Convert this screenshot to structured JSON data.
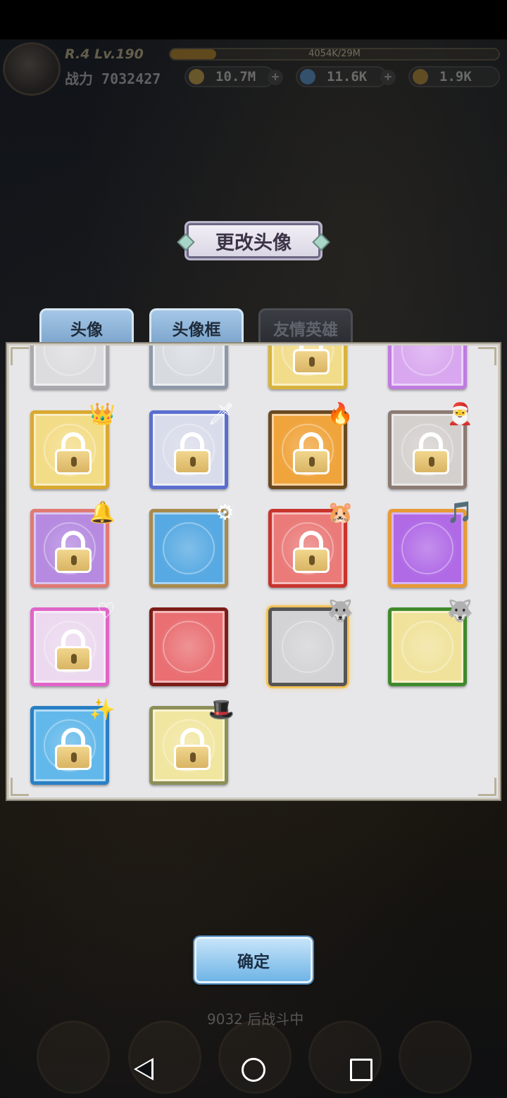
{
  "hud": {
    "level_text": "R.4 Lv.190",
    "xp_text": "4054K/29M",
    "xp_fraction": 0.14,
    "power_text": "战力 7032427",
    "resource_1": "10.7M",
    "resource_2": "11.6K",
    "resource_3": "1.9K"
  },
  "dialog": {
    "title": "更改头像",
    "tabs": [
      {
        "label": "头像",
        "state": "active"
      },
      {
        "label": "头像框",
        "state": "active"
      },
      {
        "label": "友情英雄",
        "state": "disabled"
      }
    ],
    "confirm_label": "确定"
  },
  "frames": [
    {
      "theme": "silver-plain",
      "color": "#a9a9ad",
      "inner": "#dcdcdf",
      "locked": false,
      "deco": ""
    },
    {
      "theme": "silver-ornate",
      "color": "#8d98a8",
      "inner": "#d7dbe0",
      "locked": false,
      "deco": ""
    },
    {
      "theme": "gold",
      "color": "#d8b33c",
      "inner": "#f1dc8a",
      "locked": true,
      "deco": ""
    },
    {
      "theme": "bunny-purple",
      "color": "#c07be0",
      "inner": "#d8a7ef",
      "locked": false,
      "deco": "🐰"
    },
    {
      "theme": "golden-crown",
      "color": "#d9a930",
      "inner": "#f3dc86",
      "locked": true,
      "deco": "👑"
    },
    {
      "theme": "blue-sword",
      "color": "#5b6ed0",
      "inner": "#d9dcea",
      "locked": true,
      "deco": "🗡"
    },
    {
      "theme": "orange-flame",
      "color": "#6b4a22",
      "inner": "#f0a43c",
      "locked": true,
      "deco": "🔥"
    },
    {
      "theme": "christmas-hat",
      "color": "#8b7b73",
      "inner": "#d4d0ce",
      "locked": true,
      "deco": "🎅"
    },
    {
      "theme": "winter-bell",
      "color": "#e07a72",
      "inner": "#b58ae0",
      "locked": true,
      "deco": "🔔"
    },
    {
      "theme": "blue-gear",
      "color": "#a88a4c",
      "inner": "#56a9e2",
      "locked": false,
      "deco": "⚙"
    },
    {
      "theme": "lucky-red",
      "color": "#c8342c",
      "inner": "#ea7b79",
      "locked": true,
      "deco": "🐹"
    },
    {
      "theme": "music-purple",
      "color": "#e79a36",
      "inner": "#b06ae6",
      "locked": false,
      "deco": "🎵"
    },
    {
      "theme": "pink-crown",
      "color": "#e065c8",
      "inner": "#ecd9ef",
      "locked": true,
      "deco": "♡"
    },
    {
      "theme": "dragon-red",
      "color": "#7b1d18",
      "inner": "#e96f72",
      "locked": false,
      "deco": ""
    },
    {
      "theme": "husky-silver",
      "color": "#555",
      "inner": "#d3d3d6",
      "locked": false,
      "deco": "🐺",
      "selected": true
    },
    {
      "theme": "wolf-green",
      "color": "#3f8a2c",
      "inner": "#f0e29a",
      "locked": false,
      "deco": "🐺"
    },
    {
      "theme": "ice-blue",
      "color": "#2a7fc4",
      "inner": "#62b8ea",
      "locked": true,
      "deco": "✨"
    },
    {
      "theme": "top-hat",
      "color": "#8c8f58",
      "inner": "#f1e6a0",
      "locked": true,
      "deco": "🎩"
    }
  ],
  "battle_text": "9032 后战斗中"
}
